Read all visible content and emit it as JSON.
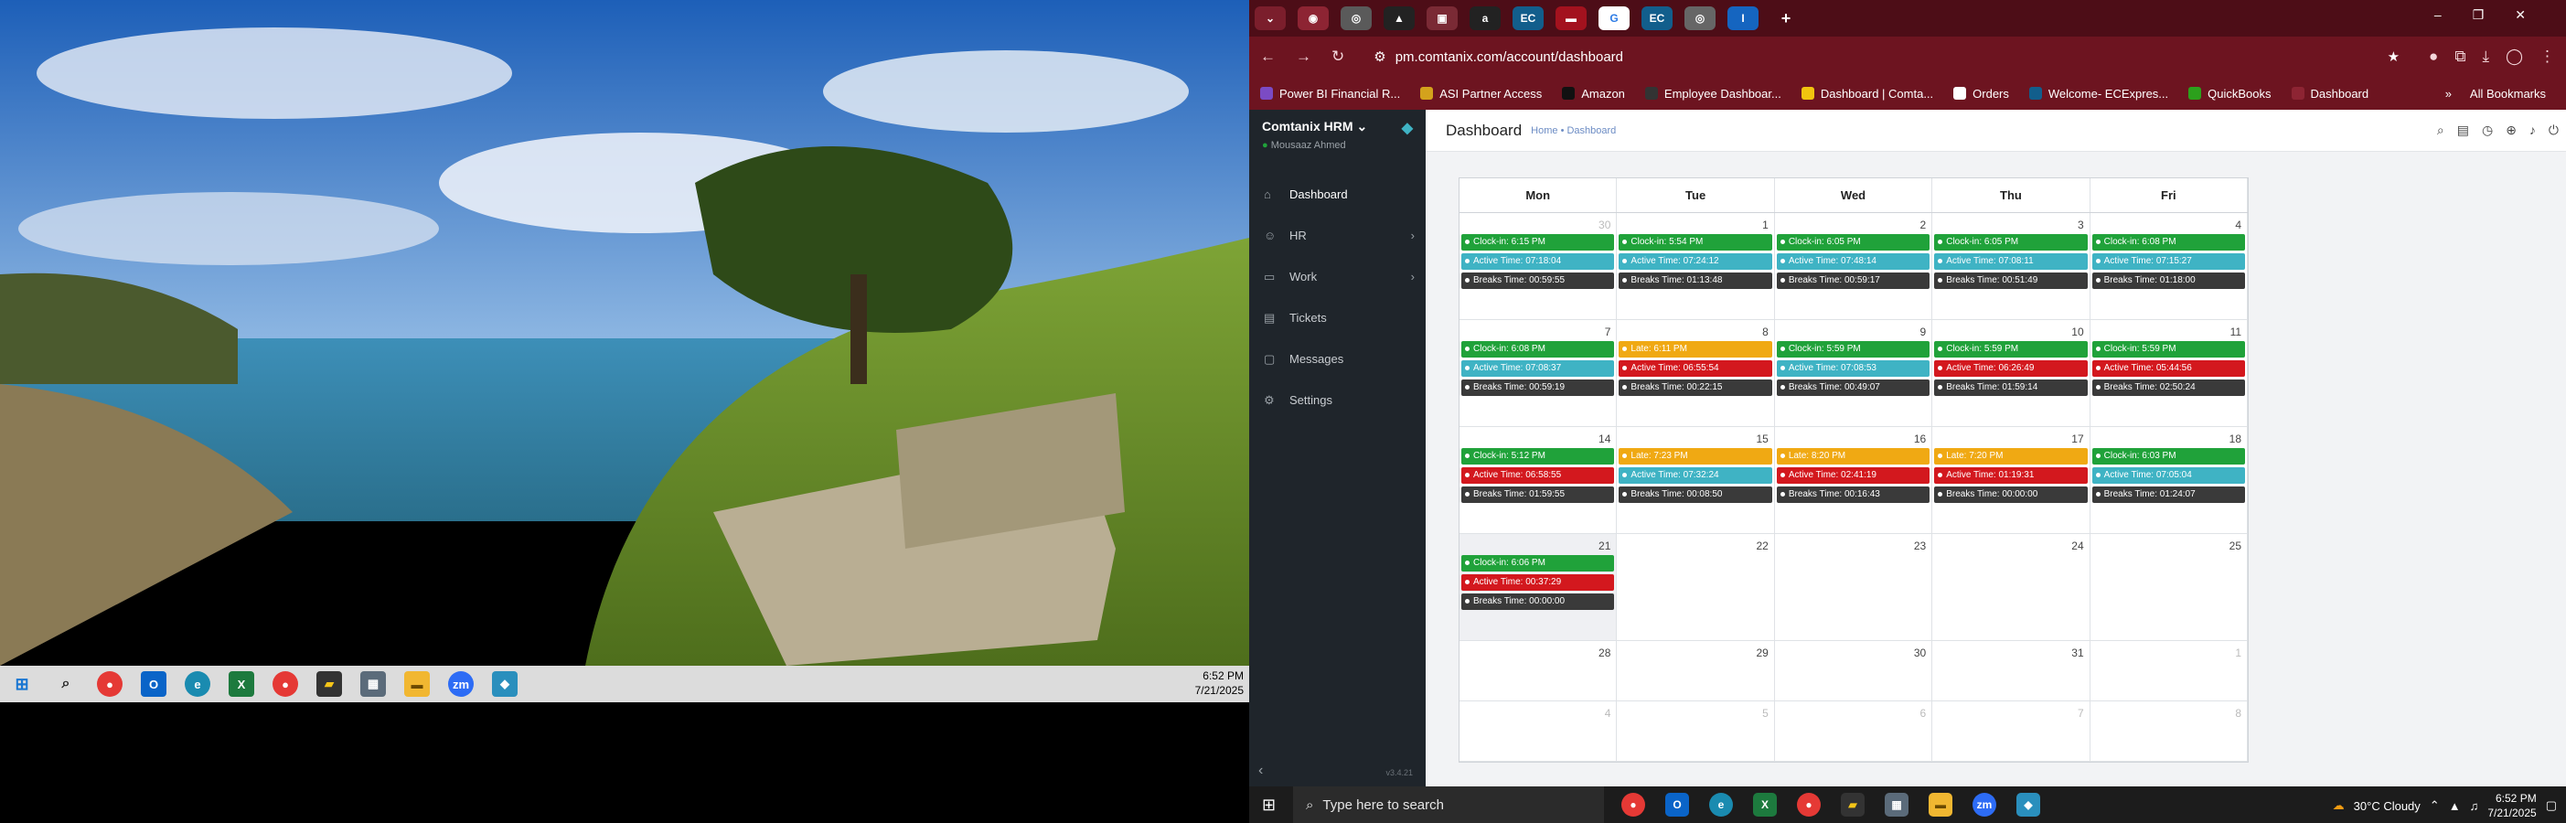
{
  "left_screen": {
    "taskbar": {
      "icons": [
        "windows-icon",
        "search-icon",
        "chrome-icon",
        "outlook-icon",
        "edge-icon",
        "excel-icon",
        "chrome-icon",
        "sticky-notes-icon",
        "calculator-icon",
        "file-explorer-icon",
        "zoom-icon",
        "app-icon"
      ],
      "time": "6:52 PM",
      "date": "7/21/2025"
    }
  },
  "browser": {
    "url": "pm.comtanix.com/account/dashboard",
    "bookmarks": [
      "Power BI Financial R...",
      "ASI Partner Access",
      "Amazon",
      "Employee Dashboar...",
      "Dashboard | Comta...",
      "Orders",
      "Welcome- ECExpres...",
      "QuickBooks",
      "Dashboard"
    ],
    "all_bookmarks": "All Bookmarks"
  },
  "app": {
    "brand": "Comtanix HRM",
    "user": "Mousaaz Ahmed",
    "version": "v3.4.21",
    "nav": [
      {
        "label": "Dashboard",
        "icon": "home-icon"
      },
      {
        "label": "HR",
        "icon": "users-icon"
      },
      {
        "label": "Work",
        "icon": "briefcase-icon"
      },
      {
        "label": "Tickets",
        "icon": "ticket-icon"
      },
      {
        "label": "Messages",
        "icon": "message-icon"
      },
      {
        "label": "Settings",
        "icon": "gear-icon"
      }
    ],
    "page_title": "Dashboard",
    "breadcrumb": "Home • Dashboard"
  },
  "calendar": {
    "days": [
      "Mon",
      "Tue",
      "Wed",
      "Thu",
      "Fri"
    ],
    "weeks": [
      [
        {
          "n": "30",
          "m": true,
          "ev": [
            [
              "g",
              "Clock-in: 6:15 PM"
            ],
            [
              "b",
              "Active Time: 07:18:04"
            ],
            [
              "d",
              "Breaks Time: 00:59:55"
            ]
          ]
        },
        {
          "n": "1",
          "ev": [
            [
              "g",
              "Clock-in: 5:54 PM"
            ],
            [
              "b",
              "Active Time: 07:24:12"
            ],
            [
              "d",
              "Breaks Time: 01:13:48"
            ]
          ]
        },
        {
          "n": "2",
          "ev": [
            [
              "g",
              "Clock-in: 6:05 PM"
            ],
            [
              "b",
              "Active Time: 07:48:14"
            ],
            [
              "d",
              "Breaks Time: 00:59:17"
            ]
          ]
        },
        {
          "n": "3",
          "ev": [
            [
              "g",
              "Clock-in: 6:05 PM"
            ],
            [
              "b",
              "Active Time: 07:08:11"
            ],
            [
              "d",
              "Breaks Time: 00:51:49"
            ]
          ]
        },
        {
          "n": "4",
          "ev": [
            [
              "g",
              "Clock-in: 6:08 PM"
            ],
            [
              "b",
              "Active Time: 07:15:27"
            ],
            [
              "d",
              "Breaks Time: 01:18:00"
            ]
          ]
        }
      ],
      [
        {
          "n": "7",
          "ev": [
            [
              "g",
              "Clock-in: 6:08 PM"
            ],
            [
              "b",
              "Active Time: 07:08:37"
            ],
            [
              "d",
              "Breaks Time: 00:59:19"
            ]
          ]
        },
        {
          "n": "8",
          "ev": [
            [
              "o",
              "Late: 6:11 PM"
            ],
            [
              "r",
              "Active Time: 06:55:54"
            ],
            [
              "d",
              "Breaks Time: 00:22:15"
            ]
          ]
        },
        {
          "n": "9",
          "ev": [
            [
              "g",
              "Clock-in: 5:59 PM"
            ],
            [
              "b",
              "Active Time: 07:08:53"
            ],
            [
              "d",
              "Breaks Time: 00:49:07"
            ]
          ]
        },
        {
          "n": "10",
          "ev": [
            [
              "g",
              "Clock-in: 5:59 PM"
            ],
            [
              "r",
              "Active Time: 06:26:49"
            ],
            [
              "d",
              "Breaks Time: 01:59:14"
            ]
          ]
        },
        {
          "n": "11",
          "ev": [
            [
              "g",
              "Clock-in: 5:59 PM"
            ],
            [
              "r",
              "Active Time: 05:44:56"
            ],
            [
              "d",
              "Breaks Time: 02:50:24"
            ]
          ]
        }
      ],
      [
        {
          "n": "14",
          "ev": [
            [
              "g",
              "Clock-in: 5:12 PM"
            ],
            [
              "r",
              "Active Time: 06:58:55"
            ],
            [
              "d",
              "Breaks Time: 01:59:55"
            ]
          ]
        },
        {
          "n": "15",
          "ev": [
            [
              "o",
              "Late: 7:23 PM"
            ],
            [
              "b",
              "Active Time: 07:32:24"
            ],
            [
              "d",
              "Breaks Time: 00:08:50"
            ]
          ]
        },
        {
          "n": "16",
          "ev": [
            [
              "o",
              "Late: 8:20 PM"
            ],
            [
              "r",
              "Active Time: 02:41:19"
            ],
            [
              "d",
              "Breaks Time: 00:16:43"
            ]
          ]
        },
        {
          "n": "17",
          "ev": [
            [
              "o",
              "Late: 7:20 PM"
            ],
            [
              "r",
              "Active Time: 01:19:31"
            ],
            [
              "d",
              "Breaks Time: 00:00:00"
            ]
          ]
        },
        {
          "n": "18",
          "ev": [
            [
              "g",
              "Clock-in: 6:03 PM"
            ],
            [
              "b",
              "Active Time: 07:05:04"
            ],
            [
              "d",
              "Breaks Time: 01:24:07"
            ]
          ]
        }
      ],
      [
        {
          "n": "21",
          "today": true,
          "ev": [
            [
              "g",
              "Clock-in: 6:06 PM"
            ],
            [
              "r",
              "Active Time: 00:37:29"
            ],
            [
              "d",
              "Breaks Time: 00:00:00"
            ]
          ]
        },
        {
          "n": "22",
          "ev": []
        },
        {
          "n": "23",
          "ev": []
        },
        {
          "n": "24",
          "ev": []
        },
        {
          "n": "25",
          "ev": []
        }
      ],
      [
        {
          "n": "28",
          "ev": []
        },
        {
          "n": "29",
          "ev": []
        },
        {
          "n": "30",
          "ev": []
        },
        {
          "n": "31",
          "ev": []
        },
        {
          "n": "1",
          "m": true,
          "ev": []
        }
      ],
      [
        {
          "n": "4",
          "m": true,
          "ev": []
        },
        {
          "n": "5",
          "m": true,
          "ev": []
        },
        {
          "n": "6",
          "m": true,
          "ev": []
        },
        {
          "n": "7",
          "m": true,
          "ev": []
        },
        {
          "n": "8",
          "m": true,
          "ev": []
        }
      ]
    ]
  },
  "right_taskbar": {
    "search_placeholder": "Type here to search",
    "weather": "30°C  Cloudy",
    "time": "6:52 PM",
    "date": "7/21/2025"
  },
  "colors": {
    "browser_tab_bar": "#4d0d17",
    "browser_toolbar": "#6d1420",
    "sidebar": "#1f252b",
    "clock_in": "#20a23a",
    "active_ok": "#3fb3c4",
    "active_low": "#d3181e",
    "late": "#f0a913",
    "breaks": "#3a3a3a"
  }
}
